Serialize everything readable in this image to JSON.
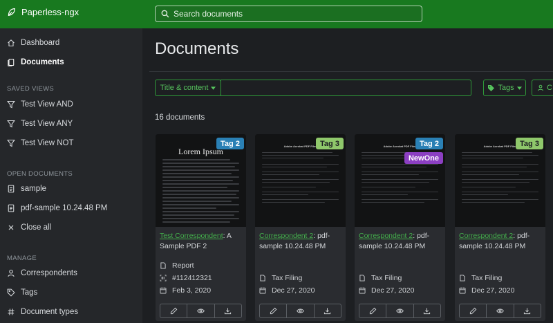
{
  "app": {
    "title": "Paperless-ngx"
  },
  "search": {
    "placeholder": "Search documents"
  },
  "sidebar": {
    "main": [
      {
        "label": "Dashboard",
        "icon": "house-icon"
      },
      {
        "label": "Documents",
        "icon": "files-icon",
        "active": true
      }
    ],
    "saved_views_heading": "SAVED VIEWS",
    "saved_views": [
      {
        "label": "Test View AND",
        "icon": "funnel-icon"
      },
      {
        "label": "Test View ANY",
        "icon": "funnel-icon"
      },
      {
        "label": "Test View NOT",
        "icon": "funnel-icon"
      }
    ],
    "open_documents_heading": "OPEN DOCUMENTS",
    "open_documents": [
      {
        "label": "sample",
        "icon": "file-text-icon"
      },
      {
        "label": "pdf-sample 10.24.48 PM",
        "icon": "file-text-icon"
      },
      {
        "label": "Close all",
        "icon": "close-icon"
      }
    ],
    "manage_heading": "MANAGE",
    "manage": [
      {
        "label": "Correspondents",
        "icon": "person-icon"
      },
      {
        "label": "Tags",
        "icon": "tag-icon"
      },
      {
        "label": "Document types",
        "icon": "hash-icon"
      }
    ]
  },
  "main": {
    "title": "Documents",
    "filter_mode": "Title & content",
    "tags_label": "Tags",
    "correspondent_label": "C",
    "count_text": "16 documents"
  },
  "colors": {
    "topbar": "#18791f",
    "accent": "#44b04c"
  },
  "documents": [
    {
      "correspondent": "Test Correspondent",
      "sep": ": ",
      "title": "A Sample PDF 2",
      "tags": [
        {
          "label": "Tag 2",
          "bg": "#2a80b5",
          "fg": "#ffffff"
        }
      ],
      "thumb_text": "Lorem Ipsum",
      "type": "Report",
      "asn": "#112412321",
      "date": "Feb 3, 2020"
    },
    {
      "correspondent": "Correspondent 2",
      "sep": ": ",
      "title": "pdf-sample 10.24.48 PM",
      "tags": [
        {
          "label": "Tag 3",
          "bg": "#8fc86b",
          "fg": "#1d1f22"
        }
      ],
      "thumb_text": "Adobe Acrobat PDF Files",
      "type": "Tax Filing",
      "date": "Dec 27, 2020"
    },
    {
      "correspondent": "Correspondent 2",
      "sep": ": ",
      "title": "pdf-sample 10.24.48 PM",
      "tags": [
        {
          "label": "Tag 2",
          "bg": "#2a80b5",
          "fg": "#ffffff"
        },
        {
          "label": "NewOne",
          "bg": "#8c3fc2",
          "fg": "#ffffff"
        }
      ],
      "thumb_text": "Adobe Acrobat PDF Files",
      "type": "Tax Filing",
      "date": "Dec 27, 2020"
    },
    {
      "correspondent": "Correspondent 2",
      "sep": ": ",
      "title": "pdf-sample 10.24.48 PM",
      "tags": [
        {
          "label": "Tag 3",
          "bg": "#8fc86b",
          "fg": "#1d1f22"
        }
      ],
      "thumb_text": "Adobe Acrobat PDF Files",
      "type": "Tax Filing",
      "date": "Dec 27, 2020"
    }
  ]
}
